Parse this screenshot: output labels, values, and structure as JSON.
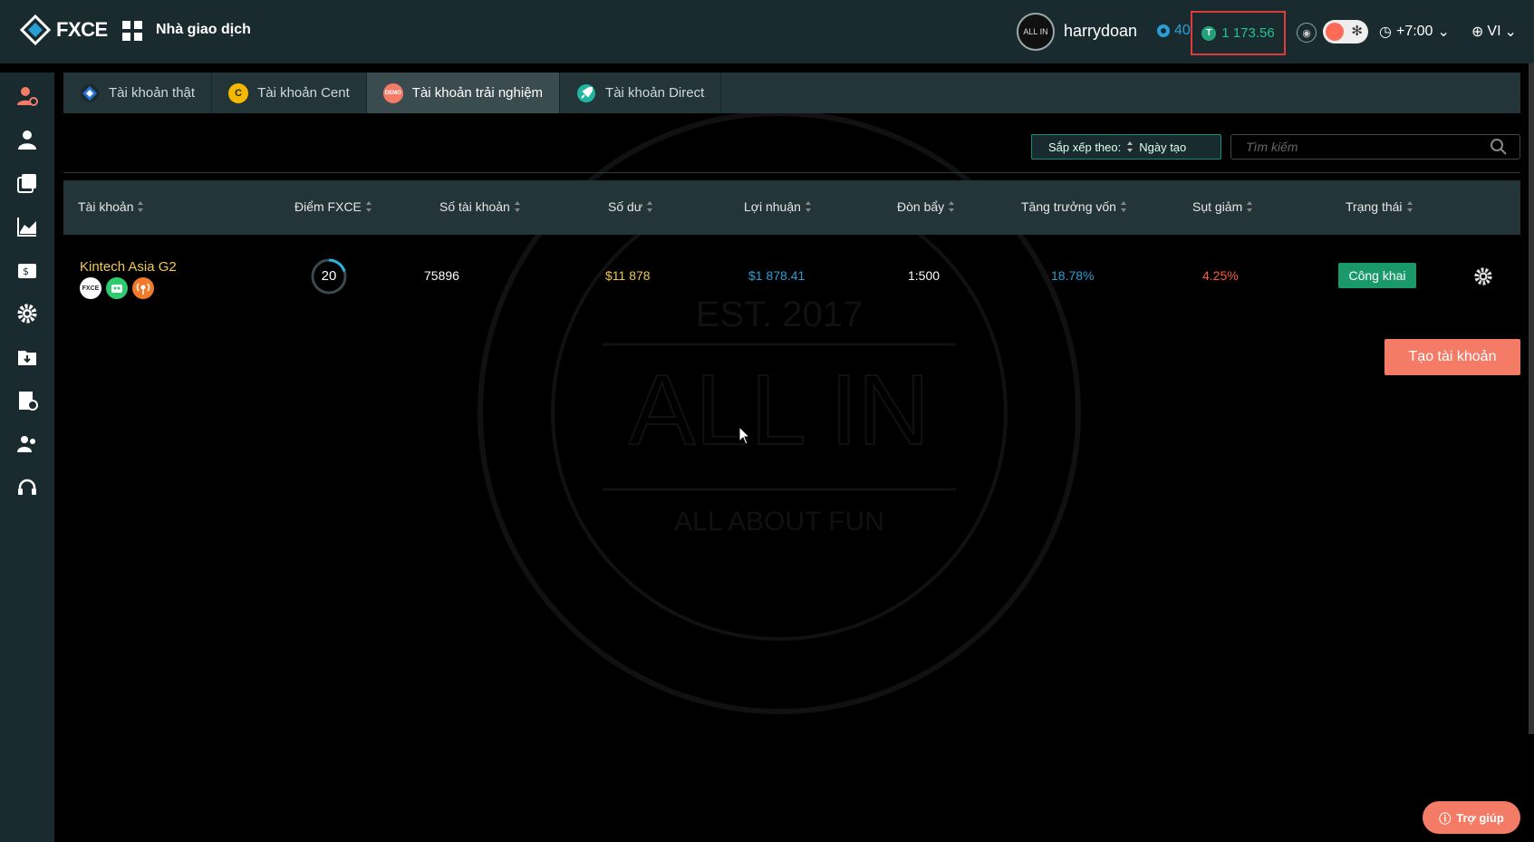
{
  "header": {
    "logo_text": "FXCE",
    "app_title": "Nhà giao dịch",
    "username": "harrydoan",
    "points": "40",
    "balance": "1 173.56",
    "balance_coin": "T",
    "timezone": "+7:00",
    "language": "VI",
    "avatar_text": "ALL IN"
  },
  "sidebar": {
    "items": [
      {
        "icon": "user-alert-icon"
      },
      {
        "icon": "user-icon"
      },
      {
        "icon": "signal-cards-icon"
      },
      {
        "icon": "chart-area-icon"
      },
      {
        "icon": "wallet-dollar-icon"
      },
      {
        "icon": "gear-icon"
      },
      {
        "icon": "folder-download-icon"
      },
      {
        "icon": "invoice-icon"
      },
      {
        "icon": "users-icon"
      },
      {
        "icon": "headset-icon"
      }
    ]
  },
  "tabs": [
    {
      "label": "Tài khoản thật",
      "icon_text": "",
      "active": false
    },
    {
      "label": "Tài khoản Cent",
      "icon_text": "C",
      "active": false
    },
    {
      "label": "Tài khoản trải nghiệm",
      "icon_text": "DEMO",
      "active": true
    },
    {
      "label": "Tài khoản Direct",
      "icon_text": "",
      "active": false
    }
  ],
  "toolbar": {
    "sort_label": "Sắp xếp theo:",
    "sort_value": "Ngày tạo",
    "search_placeholder": "Tìm kiếm"
  },
  "table": {
    "columns": [
      "Tài khoản",
      "Điểm FXCE",
      "Số tài khoản",
      "Số dư",
      "Lợi nhuận",
      "Đòn bẩy",
      "Tăng trưởng vốn",
      "Sụt giảm",
      "Trạng thái"
    ],
    "rows": [
      {
        "name": "Kintech Asia G2",
        "badges": [
          "FXCE",
          "",
          ""
        ],
        "score": "20",
        "score_fraction": 0.2,
        "account_number": "75896",
        "balance": "$11 878",
        "profit": "$1 878.41",
        "leverage": "1:500",
        "growth": "18.78%",
        "drawdown": "4.25%",
        "status": "Công khai"
      }
    ]
  },
  "create_button": "Tạo tài khoản",
  "help_button": "Trợ giúp",
  "watermark": {
    "top": "EST. 2017",
    "main": "ALL IN",
    "bottom": "ALL ABOUT FUN"
  },
  "colors": {
    "topbar": "#1a2b2f",
    "accent_orange": "#f47c67",
    "balance_green": "#22c38e",
    "gold": "#f2c94c",
    "profit_blue": "#2a9fd6",
    "drawdown_red": "#ff5a3c",
    "status_green": "#1a9a6c"
  }
}
